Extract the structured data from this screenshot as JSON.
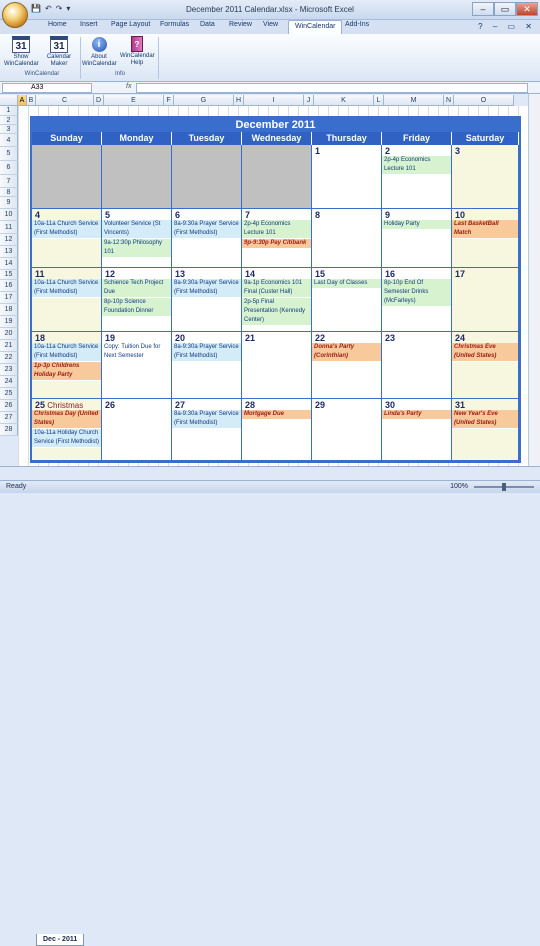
{
  "window": {
    "title": "December 2011 Calendar.xlsx - Microsoft Excel"
  },
  "qat": [
    "💾",
    "↶",
    "↷",
    "▾"
  ],
  "window_controls": [
    "–",
    "▭",
    "✕"
  ],
  "ribbon_tabs": [
    "Home",
    "Insert",
    "Page Layout",
    "Formulas",
    "Data",
    "Review",
    "View",
    "WinCalendar",
    "Add-Ins"
  ],
  "ribbon_right": "? – ▭ ✕",
  "ribbon": {
    "show_label": "Show WinCalendar",
    "maker_label": "Calendar Maker",
    "about_label": "About WinCalendar",
    "help_label": "WinCalendar Help",
    "group1": "WinCalendar",
    "group2": "Info",
    "cal_num": "31"
  },
  "formula_bar": {
    "name_box": "A33",
    "fx": "fx",
    "value": ""
  },
  "columns": [
    "A",
    "B",
    "C",
    "D",
    "E",
    "F",
    "G",
    "H",
    "I",
    "J",
    "K",
    "L",
    "M",
    "N",
    "O"
  ],
  "rows": [
    "1",
    "2",
    "3",
    "4",
    "5",
    "6",
    "7",
    "8",
    "9",
    "10",
    "11",
    "12",
    "13",
    "14",
    "15",
    "16",
    "17",
    "18",
    "19",
    "20",
    "21",
    "22",
    "23",
    "24",
    "25",
    "26",
    "27",
    "28"
  ],
  "calendar": {
    "title": "December 2011",
    "days": [
      "Sunday",
      "Monday",
      "Tuesday",
      "Wednesday",
      "Thursday",
      "Friday",
      "Saturday"
    ],
    "weeks": [
      [
        {
          "blank": true
        },
        {
          "blank": true
        },
        {
          "blank": true
        },
        {
          "blank": true
        },
        {
          "day": "1",
          "events": []
        },
        {
          "day": "2",
          "events": [
            {
              "t": "2p-4p Economics Lecture 101",
              "c": "green"
            }
          ]
        },
        {
          "day": "3",
          "events": [],
          "we": true
        }
      ],
      [
        {
          "day": "4",
          "we": true,
          "events": [
            {
              "t": "10a-11a Church Service (First Methodist)",
              "c": "blue"
            }
          ]
        },
        {
          "day": "5",
          "events": [
            {
              "t": "Volunteer Service (St Vincents)",
              "c": "blue"
            },
            {
              "t": "9a-12:30p Philosophy 101",
              "c": "green"
            }
          ]
        },
        {
          "day": "6",
          "events": [
            {
              "t": "8a-9:30a Prayer Service (First Methodist)",
              "c": "blue"
            }
          ]
        },
        {
          "day": "7",
          "events": [
            {
              "t": "2p-4p Economics Lecture 101",
              "c": "green"
            },
            {
              "t": "9p-9:30p Pay Citibank",
              "c": "orange"
            }
          ]
        },
        {
          "day": "8",
          "events": []
        },
        {
          "day": "9",
          "events": [
            {
              "t": "Holiday Party",
              "c": "green"
            }
          ]
        },
        {
          "day": "10",
          "we": true,
          "events": [
            {
              "t": "Last BasketBall Match",
              "c": "orange"
            }
          ]
        }
      ],
      [
        {
          "day": "11",
          "we": true,
          "events": [
            {
              "t": "10a-11a Church Service (First Methodist)",
              "c": "blue"
            }
          ]
        },
        {
          "day": "12",
          "events": [
            {
              "t": "Schience Tech Project Due",
              "c": "green"
            },
            {
              "t": "8p-10p Science Foundation Dinner",
              "c": "green"
            }
          ]
        },
        {
          "day": "13",
          "events": [
            {
              "t": "8a-9:30a Prayer Service (First Methodist)",
              "c": "blue"
            }
          ]
        },
        {
          "day": "14",
          "events": [
            {
              "t": "9a-1p Economics 101 Final (Custer Hall)",
              "c": "green"
            },
            {
              "t": "2p-5p Final Presentation (Kennedy Center)",
              "c": "green"
            }
          ]
        },
        {
          "day": "15",
          "events": [
            {
              "t": "Last Day of Classes",
              "c": "green"
            }
          ]
        },
        {
          "day": "16",
          "events": [
            {
              "t": "8p-10p End Of Semester Drinks (McFarleys)",
              "c": "green"
            }
          ]
        },
        {
          "day": "17",
          "we": true,
          "events": []
        }
      ],
      [
        {
          "day": "18",
          "we": true,
          "events": [
            {
              "t": "10a-11a Church Service (First Methodist)",
              "c": "blue"
            },
            {
              "t": "1p-3p Childrens Holiday Party",
              "c": "orange"
            }
          ]
        },
        {
          "day": "19",
          "events": [
            {
              "t": "Copy: Tuition Due for Next Semester",
              "c": "plain"
            }
          ]
        },
        {
          "day": "20",
          "events": [
            {
              "t": "8a-9:30a Prayer Service (First Methodist)",
              "c": "blue"
            }
          ]
        },
        {
          "day": "21",
          "events": []
        },
        {
          "day": "22",
          "events": [
            {
              "t": "Donna's Party (Corinthian)",
              "c": "orange"
            }
          ]
        },
        {
          "day": "23",
          "events": []
        },
        {
          "day": "24",
          "we": true,
          "events": [
            {
              "t": "Christmas Eve (United States)",
              "c": "orange"
            }
          ]
        }
      ],
      [
        {
          "day": "25",
          "extra": "Christmas",
          "we": true,
          "events": [
            {
              "t": "Christmas Day (United States)",
              "c": "orange"
            },
            {
              "t": "10a-11a Holiday Church Service (First Methodist)",
              "c": "blue"
            }
          ]
        },
        {
          "day": "26",
          "events": []
        },
        {
          "day": "27",
          "events": [
            {
              "t": "8a-9:30a Prayer Service (First Methodist)",
              "c": "blue"
            }
          ]
        },
        {
          "day": "28",
          "events": [
            {
              "t": "Mortgage Due",
              "c": "orange"
            }
          ]
        },
        {
          "day": "29",
          "events": []
        },
        {
          "day": "30",
          "events": [
            {
              "t": "Linda's Party",
              "c": "orange"
            }
          ]
        },
        {
          "day": "31",
          "we": true,
          "events": [
            {
              "t": "New Year's Eve (United States)",
              "c": "orange"
            }
          ]
        }
      ]
    ]
  },
  "sheet_tab": "Dec - 2011",
  "status": {
    "ready": "Ready",
    "zoom": "100%"
  }
}
